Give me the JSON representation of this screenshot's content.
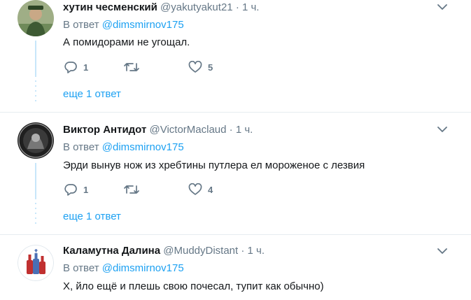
{
  "tweets": [
    {
      "name": "хутин чесменский",
      "handle": "@yakutyakut21",
      "time": "· 1 ч.",
      "reply_prefix": "В ответ",
      "reply_to": "@dimsmirnov175",
      "text": "А помидорами не угощал.",
      "replies": "1",
      "retweets": "",
      "likes": "5",
      "more_replies": "еще 1 ответ"
    },
    {
      "name": "Виктор Антидот",
      "handle": "@VictorMaclaud",
      "time": "· 1 ч.",
      "reply_prefix": "В ответ",
      "reply_to": "@dimsmirnov175",
      "text": "Эрди вынув нож из хребтины путлера ел мороженое с лезвия",
      "replies": "1",
      "retweets": "",
      "likes": "4",
      "more_replies": "еще 1 ответ"
    },
    {
      "name": "Каламутна Далина",
      "handle": "@MuddyDistant",
      "time": "· 1 ч.",
      "reply_prefix": "В ответ",
      "reply_to": "@dimsmirnov175",
      "text": "Х, йло ещё и плешь свою почесал, тупит как обычно)"
    }
  ],
  "colors": {
    "link": "#1da1f2",
    "secondary": "#657786",
    "primary_text": "#14171a",
    "thread_line": "#c8e6fa",
    "separator": "#e6ecf0"
  }
}
